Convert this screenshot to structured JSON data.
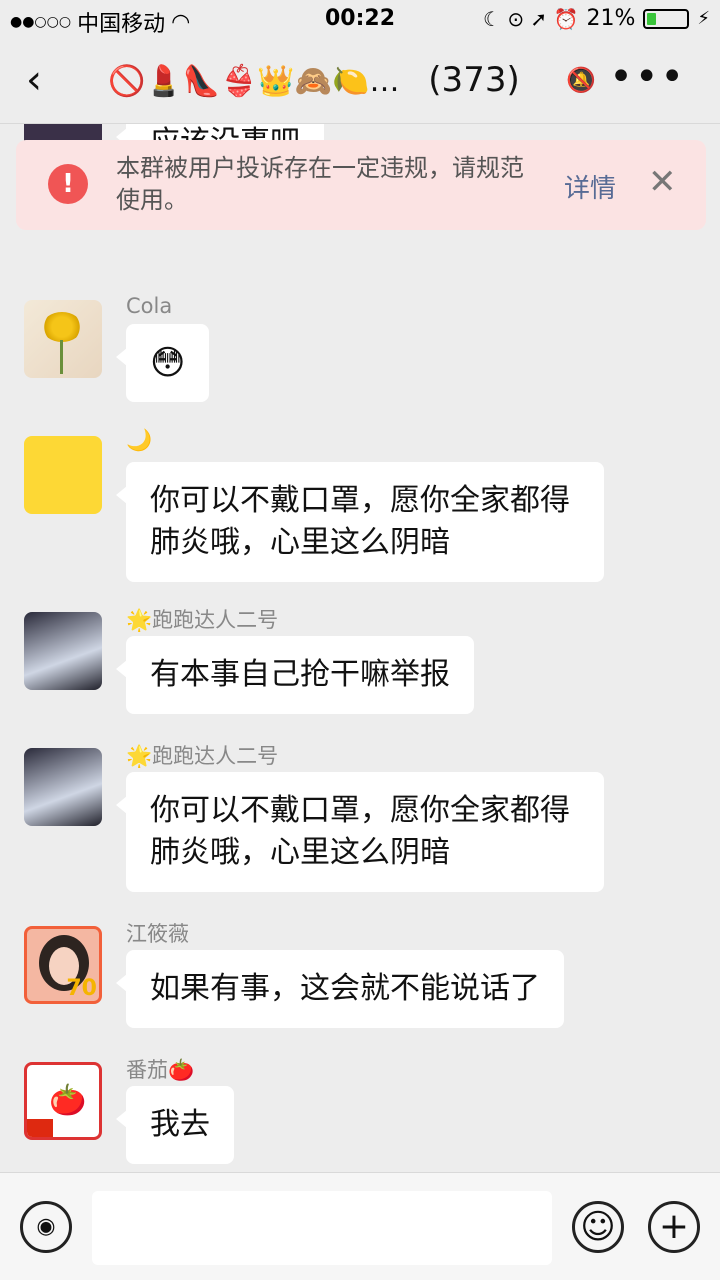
{
  "status_bar": {
    "signal": "●●○○○",
    "carrier": "中国移动",
    "wifi_icon": "◠",
    "time": "00:22",
    "status_icons": "☾ ⊙ ➚ ⏰",
    "battery_percent": "21%",
    "battery_level": 0.21,
    "charging_icon": "⚡"
  },
  "nav": {
    "back_icon": "‹",
    "group_name": "🚫💄👠👙👑🙈🍋…",
    "member_count": "(373)",
    "mute_icon": "🔕",
    "more_icon": "•••"
  },
  "banner": {
    "warn_icon": "!",
    "message": "本群被用户投诉存在一定违规，请规范使用。",
    "detail_label": "详情",
    "close_icon": "✕"
  },
  "messages": [
    {
      "sender": "",
      "text": "应该没事吧"
    },
    {
      "sender": "Cola",
      "text": "😳"
    },
    {
      "sender": "🌙",
      "text": "你可以不戴口罩，愿你全家都得肺炎哦，心里这么阴暗"
    },
    {
      "sender": "🌟跑跑达人二号",
      "text": "有本事自己抢干嘛举报"
    },
    {
      "sender": "🌟跑跑达人二号",
      "text": "你可以不戴口罩，愿你全家都得肺炎哦，心里这么阴暗"
    },
    {
      "sender": "江筱薇",
      "text": "如果有事，这会就不能说话了"
    },
    {
      "sender": "番茄🍅",
      "text": "我去"
    }
  ],
  "avatar_badges": {
    "jiang": "70",
    "fanqie": "🍅"
  },
  "input_bar": {
    "voice_icon": "◉",
    "emoji_icon": "☺",
    "plus_icon": "+"
  }
}
